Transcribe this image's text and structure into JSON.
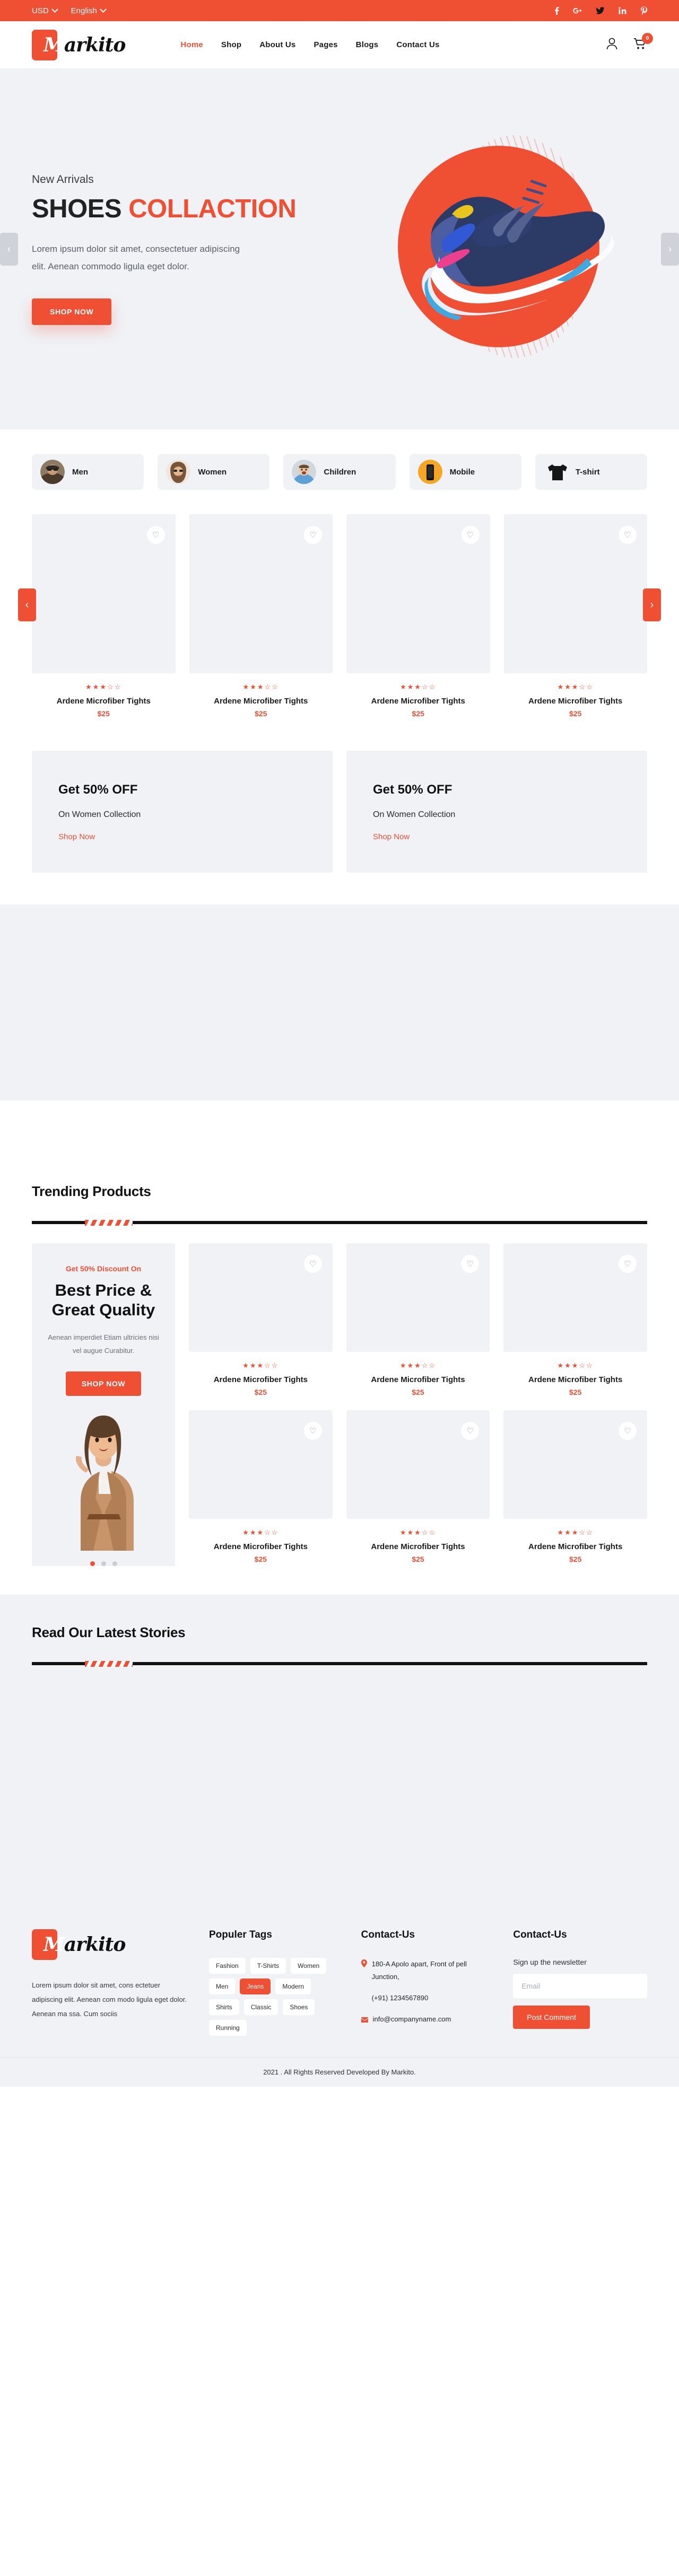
{
  "brand": {
    "name_m": "M",
    "name_rest": "arkito",
    "accent": "#ef5033"
  },
  "topbar": {
    "currency": "USD",
    "language": "English",
    "socials": [
      {
        "name": "facebook-icon",
        "label": "f"
      },
      {
        "name": "google-plus-icon",
        "label": "G+"
      },
      {
        "name": "twitter-icon",
        "label": "t"
      },
      {
        "name": "linkedin-icon",
        "label": "in"
      },
      {
        "name": "pinterest-icon",
        "label": "P"
      }
    ]
  },
  "nav": {
    "items": [
      {
        "label": "Home",
        "active": true
      },
      {
        "label": "Shop",
        "active": false
      },
      {
        "label": "About Us",
        "active": false
      },
      {
        "label": "Pages",
        "active": false
      },
      {
        "label": "Blogs",
        "active": false
      },
      {
        "label": "Contact Us",
        "active": false
      }
    ],
    "cart_count": "0"
  },
  "hero": {
    "kicker": "New Arrivals",
    "title_black": "SHOES",
    "title_accent": "COLLACTION",
    "description": "Lorem ipsum dolor sit amet, consectetuer adipiscing elit. Aenean commodo ligula eget dolor.",
    "cta": "SHOP NOW",
    "prev": "‹",
    "next": "›"
  },
  "categories": [
    {
      "label": "Men",
      "icon": "category-men-photo"
    },
    {
      "label": "Women",
      "icon": "category-women-photo"
    },
    {
      "label": "Children",
      "icon": "category-children-photo"
    },
    {
      "label": "Mobile",
      "icon": "category-mobile-photo"
    },
    {
      "label": "T-shirt",
      "icon": "category-tshirt-photo"
    }
  ],
  "product_carousel": {
    "prev": "‹",
    "next": "›",
    "items": [
      {
        "name": "Ardene Microfiber Tights",
        "price": "$25",
        "rating": 3,
        "stars": "★★★☆☆"
      },
      {
        "name": "Ardene Microfiber Tights",
        "price": "$25",
        "rating": 3,
        "stars": "★★★☆☆"
      },
      {
        "name": "Ardene Microfiber Tights",
        "price": "$25",
        "rating": 3,
        "stars": "★★★☆☆"
      },
      {
        "name": "Ardene Microfiber Tights",
        "price": "$25",
        "rating": 3,
        "stars": "★★★☆☆"
      }
    ]
  },
  "promos": [
    {
      "title": "Get 50% OFF",
      "subtitle": "On Women Collection",
      "link": "Shop Now"
    },
    {
      "title": "Get 50% OFF",
      "subtitle": "On Women Collection",
      "link": "Shop Now"
    }
  ],
  "trending": {
    "heading": "Trending Products",
    "promo": {
      "kicker": "Get 50% Discount On",
      "title": "Best Price & Great Quality",
      "text": "Aenean imperdiet Etiam ultricies nisi vel augue Curabitur.",
      "cta": "SHOP NOW"
    },
    "products": [
      {
        "name": "Ardene Microfiber Tights",
        "price": "$25",
        "stars": "★★★☆☆"
      },
      {
        "name": "Ardene Microfiber Tights",
        "price": "$25",
        "stars": "★★★☆☆"
      },
      {
        "name": "Ardene Microfiber Tights",
        "price": "$25",
        "stars": "★★★☆☆"
      },
      {
        "name": "Ardene Microfiber Tights",
        "price": "$25",
        "stars": "★★★☆☆"
      },
      {
        "name": "Ardene Microfiber Tights",
        "price": "$25",
        "stars": "★★★☆☆"
      },
      {
        "name": "Ardene Microfiber Tights",
        "price": "$25",
        "stars": "★★★☆☆"
      }
    ]
  },
  "stories": {
    "heading": "Read Our Latest Stories"
  },
  "footer": {
    "about": "Lorem ipsum dolor sit amet, cons ectetuer adipiscing elit. Aenean com modo ligula eget dolor. Aenean ma ssa. Cum sociis",
    "tags_heading": "Populer Tags",
    "tags": [
      {
        "label": "Fashion",
        "active": false
      },
      {
        "label": "T-Shirts",
        "active": false
      },
      {
        "label": "Women",
        "active": false
      },
      {
        "label": "Men",
        "active": false
      },
      {
        "label": "Jeans",
        "active": true
      },
      {
        "label": "Modern",
        "active": false
      },
      {
        "label": "Shirts",
        "active": false
      },
      {
        "label": "Classic",
        "active": false
      },
      {
        "label": "Shoes",
        "active": false
      },
      {
        "label": "Running",
        "active": false
      }
    ],
    "contact_heading": "Contact-Us",
    "address": "180-A Apolo apart, Front of pell Junction,",
    "phone": "(+91) 1234567890",
    "email": "info@companyname.com",
    "newsletter_heading": "Contact-Us",
    "newsletter_label": "Sign up the newsletter",
    "email_placeholder": "Email",
    "email_value": "",
    "post_button": "Post Comment"
  },
  "copyright": "2021 . All Rights Reserved Developed By Markito."
}
